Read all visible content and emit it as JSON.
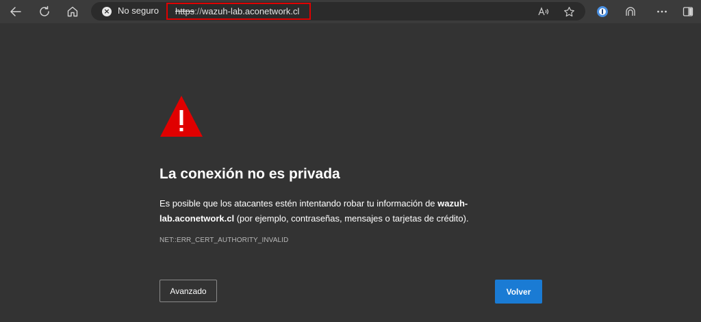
{
  "address_bar": {
    "security_label": "No seguro",
    "url_scheme": "https",
    "url_separator": "://",
    "url_host": "wazuh-lab.aconetwork.cl"
  },
  "icons": {
    "back": "arrow-left",
    "refresh": "refresh",
    "home": "home",
    "security": "x-circle",
    "read_aloud": "read-aloud",
    "favorite": "star",
    "password_manager": "circle-badge",
    "copilot": "arch",
    "more": "ellipsis",
    "sidebar": "sidebar"
  },
  "error_page": {
    "heading": "La conexión no es privada",
    "body_prefix": "Es posible que los atacantes estén intentando robar tu información de ",
    "body_host": "wazuh-lab.aconetwork.cl",
    "body_suffix": " (por ejemplo, contraseñas, mensajes o tarjetas de crédito).",
    "error_code": "NET::ERR_CERT_AUTHORITY_INVALID",
    "advanced_button": "Avanzado",
    "back_button": "Volver"
  },
  "colors": {
    "page_background": "#333333",
    "warning_red": "#e00000",
    "primary_button": "#1a7bd4",
    "url_highlight_border": "#e00000"
  }
}
